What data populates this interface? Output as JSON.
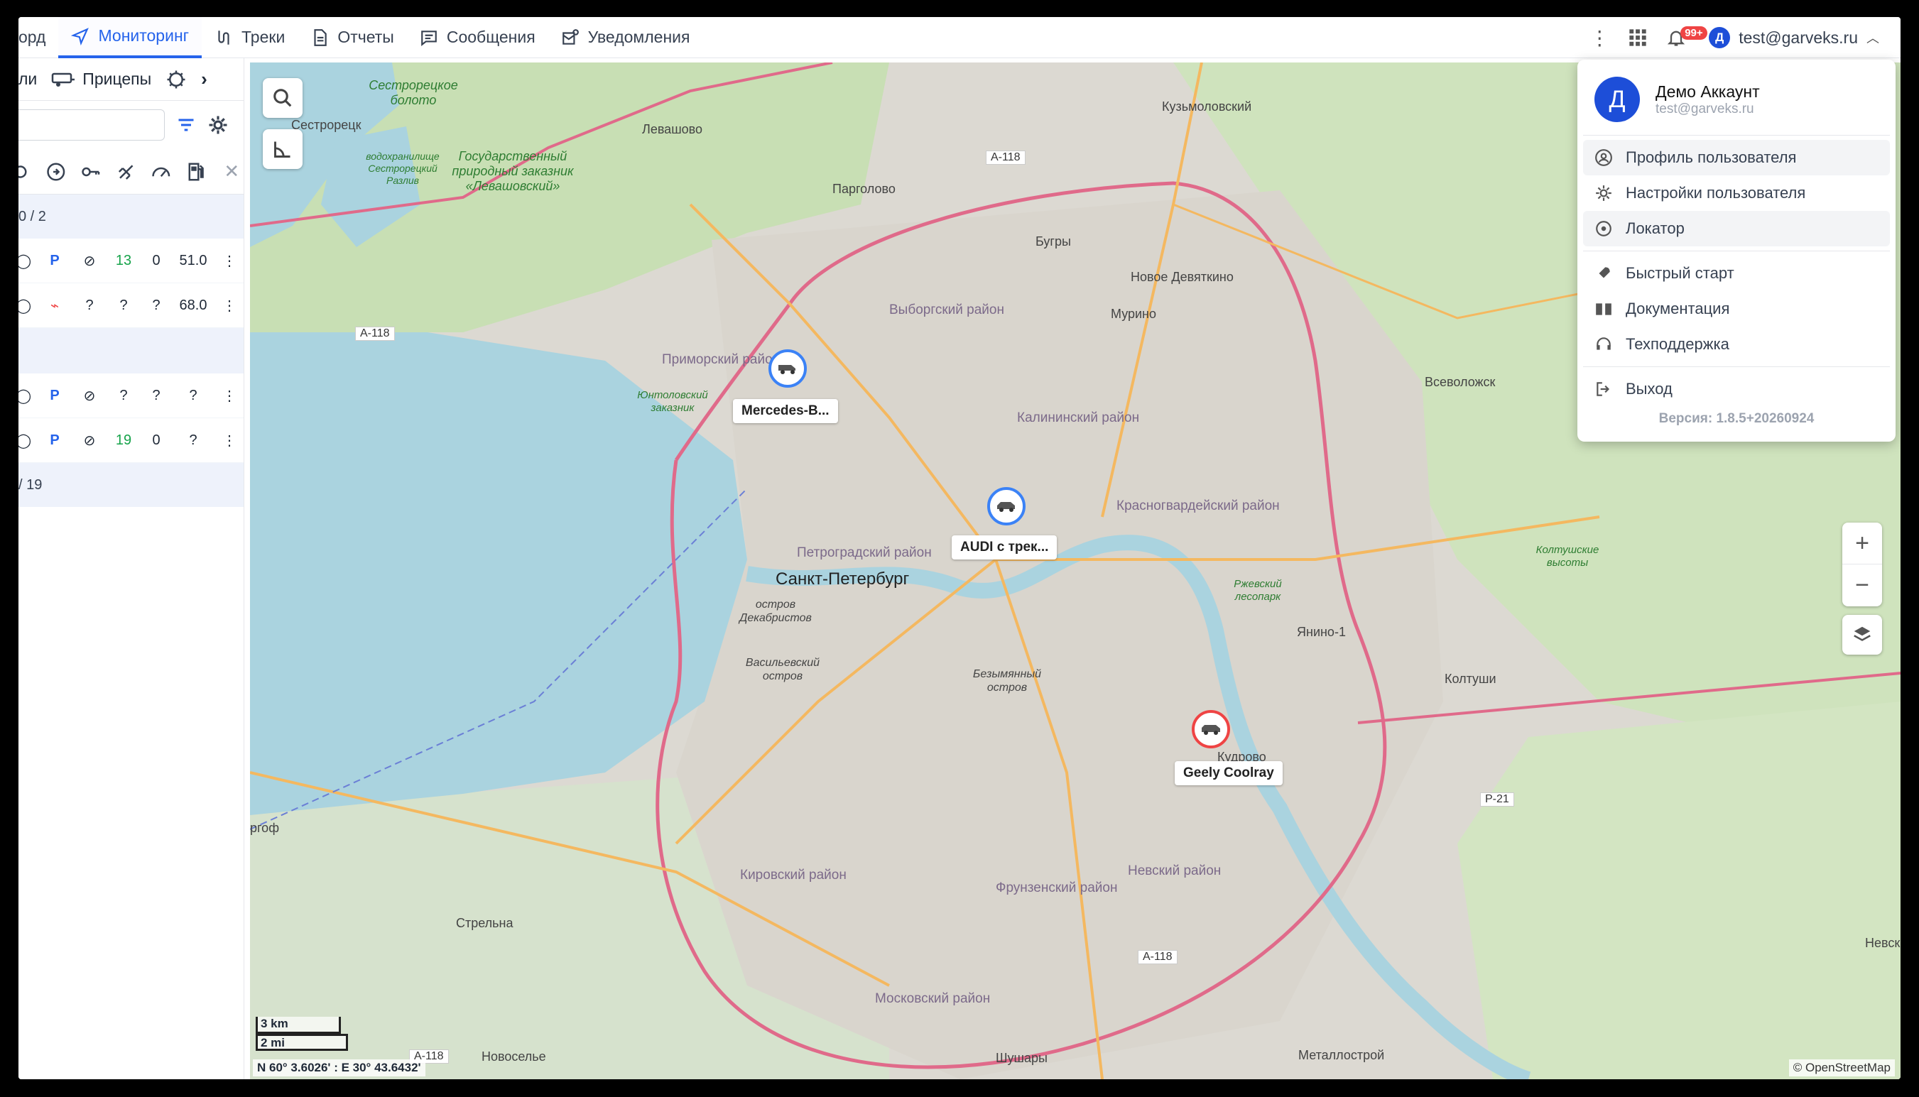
{
  "nav": {
    "partial_first": "орд",
    "tabs": [
      {
        "label": "Мониторинг",
        "active": true
      },
      {
        "label": "Треки"
      },
      {
        "label": "Отчеты"
      },
      {
        "label": "Сообщения"
      },
      {
        "label": "Уведомления"
      }
    ],
    "notif_badge": "99+",
    "user_initial": "Д",
    "user_email": "test@garveks.ru"
  },
  "left": {
    "tab_partial": "ли",
    "tab_trailers": "Прицепы",
    "search_placeholder": "",
    "groups": [
      {
        "label": "0 / 2"
      },
      {
        "label": "/ 19"
      }
    ],
    "rows": [
      {
        "p": "P",
        "v1": "13",
        "v2": "0",
        "v3": "51.0",
        "v1_color": "green"
      },
      {
        "p": "?",
        "v1": "?",
        "v2": "?",
        "v3": "68.0"
      },
      {
        "p": "P",
        "v1": "?",
        "v2": "?",
        "v3": "?"
      },
      {
        "p": "P",
        "v1": "19",
        "v2": "0",
        "v3": "?",
        "v1_color": "green"
      }
    ]
  },
  "map": {
    "labels": {
      "spb": "Санкт-Петербург",
      "sestroretsk": "Сестрорецк",
      "levashovo": "Левашово",
      "pargolovo": "Парголово",
      "bugry": "Бугры",
      "novoe_devyatkino": "Новое Девяткино",
      "murino": "Мурино",
      "kuzmolovsky": "Кузьмоловский",
      "vsevolozhsk": "Всеволожск",
      "yanino": "Янино-1",
      "koltushi": "Колтуши",
      "kudrovo": "Кудрово",
      "nevskaya": "Невская",
      "strelna": "Стрельна",
      "novoselye": "Новоселье",
      "shushary": "Шушары",
      "metallostroy": "Металлострой",
      "rgof": "ргоф",
      "vyborgsky": "Выборгский район",
      "primorsky": "Приморский район",
      "kalininsky": "Калининский район",
      "krasnogvardeysky": "Красногвардейский район",
      "petrogradsky": "Петроградский район",
      "kirovsky": "Кировский район",
      "frunzensky": "Фрунзенский район",
      "nevsky": "Невский район",
      "moskovsky": "Московский район",
      "vasileostrovsky": "Васильевский остров",
      "dekabristov": "остров Декабристов",
      "bezymyanny": "Безымянный остров",
      "sestroretskoe_boloto": "Сестрорецкое болото",
      "levashovsky_zakaznik": "Государственный природный заказник «Левашовский»",
      "vodokhranilishche": "водохранилище Сестрорецкий Разлив",
      "yuntolovsky": "Юнтоловский заказник",
      "koltushskie": "Колтушские высоты",
      "rzhevsky": "Ржевский лесопарк"
    },
    "roads": [
      "А-118",
      "А-118",
      "А-118",
      "А-118",
      "Р-21"
    ],
    "vehicles": [
      {
        "name": "Mercedes-B...",
        "color": "#3b82f6"
      },
      {
        "name": "AUDI с трек...",
        "color": "#3b82f6"
      },
      {
        "name": "Geely Coolray",
        "color": "#ef4444"
      }
    ],
    "scale_km": "3 km",
    "scale_mi": "2 mi",
    "coords": "N 60° 3.6026' : E 30° 43.6432'",
    "attribution": "© OpenStreetMap"
  },
  "dropdown": {
    "initial": "Д",
    "name": "Демо Аккаунт",
    "email": "test@garveks.ru",
    "items1": [
      "Профиль пользователя",
      "Настройки пользователя",
      "Локатор"
    ],
    "items2": [
      "Быстрый старт",
      "Документация",
      "Техподдержка"
    ],
    "logout": "Выход",
    "version": "Версия: 1.8.5+20260924"
  }
}
